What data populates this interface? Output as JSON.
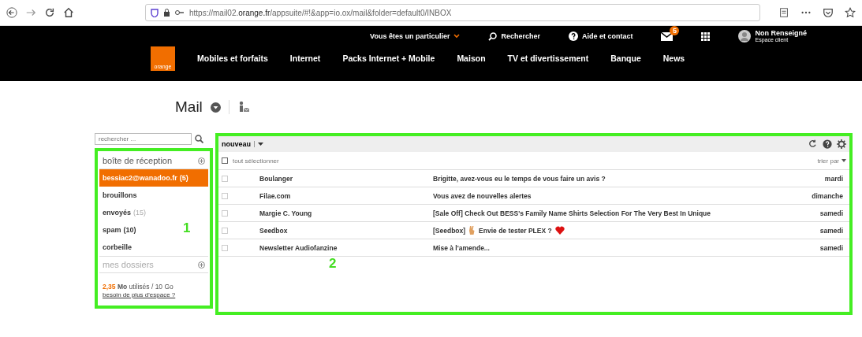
{
  "browser": {
    "url_prefix": "https://mail02.",
    "url_domain": "orange.fr",
    "url_rest": "/appsuite/#!&app=io.ox/mail&folder=default0/INBOX"
  },
  "topbar": {
    "segment": "Vous êtes un particulier",
    "search": "Rechercher",
    "help": "Aide et contact",
    "mail_badge": "5",
    "user_name": "Non Renseigné",
    "user_sub": "Espace client"
  },
  "logo": "orange",
  "nav": [
    "Mobiles et forfaits",
    "Internet",
    "Packs Internet + Mobile",
    "Maison",
    "TV et divertissement",
    "Banque",
    "News"
  ],
  "page_title": "Mail",
  "sidebar": {
    "search_placeholder": "rechercher ...",
    "inbox_header": "boîte de réception",
    "folders": [
      {
        "name": "bessiac2@wanadoo.fr",
        "count": "(5)",
        "selected": true,
        "count_muted": false
      },
      {
        "name": "brouillons",
        "selected": false
      },
      {
        "name": "envoyés",
        "count": "(15)",
        "selected": false,
        "count_muted": true
      },
      {
        "name": "spam",
        "count": "(10)",
        "selected": false,
        "count_muted": false
      },
      {
        "name": "corbeille",
        "selected": false
      }
    ],
    "my_folders": "mes dossiers",
    "quota_used": "2,35",
    "quota_unit": "Mo",
    "quota_rest": "utilisés / 10 Go",
    "quota_link": "besoin de plus d'espace ?"
  },
  "toolbar": {
    "new": "nouveau",
    "select_all": "tout sélectionner",
    "select_all_checked": false,
    "sort": "trier par"
  },
  "messages": [
    {
      "sender": "Boulanger",
      "subject": [
        {
          "kind": "text",
          "text": "Brigitte, avez-vous eu le temps de vous faire un avis ?"
        }
      ],
      "date": "mardi",
      "checked": false
    },
    {
      "sender": "Filae.com",
      "subject": [
        {
          "kind": "text",
          "text": "Vous avez de nouvelles alertes"
        }
      ],
      "date": "dimanche",
      "checked": false
    },
    {
      "sender": "Margie C. Young",
      "subject": [
        {
          "kind": "text",
          "text": "[Sale Off] Check Out BESS's Family Name Shirts Selection For The Very Best In Unique"
        }
      ],
      "date": "samedi",
      "checked": false
    },
    {
      "sender": "Seedbox",
      "subject": [
        {
          "kind": "text",
          "text": "[Seedbox]"
        },
        {
          "kind": "hand"
        },
        {
          "kind": "text",
          "text": "Envie de tester PLEX ?"
        },
        {
          "kind": "heart"
        }
      ],
      "date": "samedi",
      "checked": false
    },
    {
      "sender": "Newsletter Audiofanzine",
      "subject": [
        {
          "kind": "text",
          "text": "Mise à l'amende..."
        }
      ],
      "date": "samedi",
      "checked": false
    }
  ],
  "annotations": [
    "1",
    "2"
  ]
}
